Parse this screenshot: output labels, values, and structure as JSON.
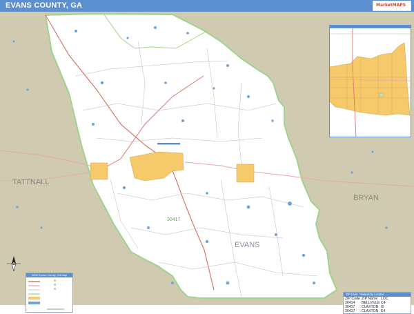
{
  "title": "EVANS COUNTY, GA",
  "logo": {
    "text": "MarketMAPS"
  },
  "regions": {
    "west": "TATTNALL",
    "east": "BRYAN",
    "county": "EVANS",
    "zip": "30417"
  },
  "legend": {
    "title": "2018 Evans County, GA Map"
  },
  "zip_table": {
    "title": "ZIP Code / Metro/City Locator",
    "headers": [
      "ZIP Code",
      "ZIP Name",
      "LOC"
    ],
    "rows": [
      [
        "30414",
        "BELLVILLE",
        "C4"
      ],
      [
        "30417",
        "CLAXTON",
        "I2"
      ],
      [
        "30417",
        "CLAXTON",
        "E4"
      ]
    ]
  },
  "colors": {
    "title_bar": "#5b8fd0",
    "outside": "#cfcab0",
    "county_fill": "#ffffff",
    "county_border": "#9fd38f",
    "city_fill": "#f6c96b",
    "water": "#6fa4d8",
    "highway": "#d9776c"
  }
}
